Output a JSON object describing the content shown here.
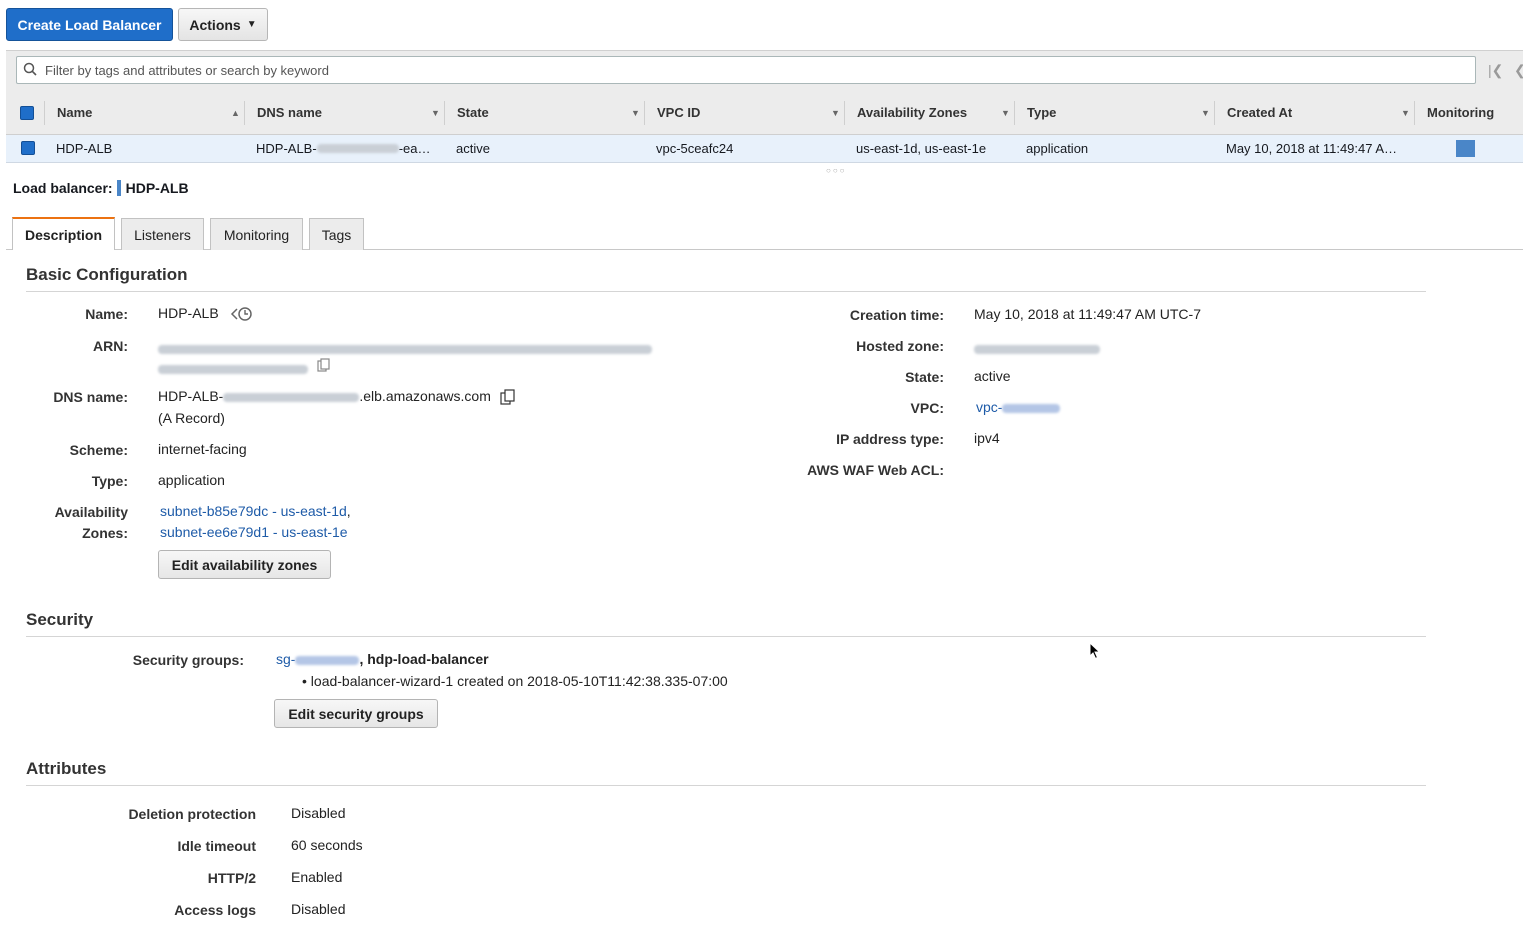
{
  "toolbar": {
    "create_label": "Create Load Balancer",
    "actions_label": "Actions"
  },
  "search": {
    "placeholder": "Filter by tags and attributes or search by keyword"
  },
  "table": {
    "columns": [
      "Name",
      "DNS name",
      "State",
      "VPC ID",
      "Availability Zones",
      "Type",
      "Created At",
      "Monitoring"
    ],
    "rows": [
      {
        "name": "HDP-ALB",
        "dns_prefix": "HDP-ALB-",
        "dns_suffix": "-ea…",
        "state": "active",
        "vpc": "vpc-5ceafc24",
        "azs": "us-east-1d, us-east-1e",
        "type": "application",
        "created": "May 10, 2018 at 11:49:47 A…"
      }
    ]
  },
  "detail": {
    "title_label": "Load balancer:",
    "title_value": "HDP-ALB",
    "tabs": [
      "Description",
      "Listeners",
      "Monitoring",
      "Tags"
    ]
  },
  "basic": {
    "heading": "Basic Configuration",
    "name_label": "Name:",
    "name_value": "HDP-ALB",
    "arn_label": "ARN:",
    "dns_label": "DNS name:",
    "dns_prefix": "HDP-ALB-",
    "dns_suffix": ".elb.amazonaws.com",
    "dns_record": "(A Record)",
    "scheme_label": "Scheme:",
    "scheme_value": "internet-facing",
    "type_label": "Type:",
    "type_value": "application",
    "az_label_1": "Availability",
    "az_label_2": "Zones:",
    "az_1": "subnet-b85e79dc - us-east-1d",
    "az_2": "subnet-ee6e79d1 - us-east-1e",
    "edit_az": "Edit availability zones",
    "creation_label": "Creation time:",
    "creation_value": "May 10, 2018 at 11:49:47 AM UTC-7",
    "hosted_label": "Hosted zone:",
    "state_label": "State:",
    "state_value": "active",
    "vpc_label": "VPC:",
    "vpc_prefix": "vpc-",
    "ip_label": "IP address type:",
    "ip_value": "ipv4",
    "waf_label": "AWS WAF Web ACL:"
  },
  "security": {
    "heading": "Security",
    "sg_label": "Security groups:",
    "sg_prefix": "sg-",
    "sg_name": ", hdp-load-balancer",
    "sg_desc": "• load-balancer-wizard-1 created on 2018-05-10T11:42:38.335-07:00",
    "edit_sg": "Edit security groups"
  },
  "attributes": {
    "heading": "Attributes",
    "items": [
      {
        "label": "Deletion protection",
        "value": "Disabled"
      },
      {
        "label": "Idle timeout",
        "value": "60 seconds"
      },
      {
        "label": "HTTP/2",
        "value": "Enabled"
      },
      {
        "label": "Access logs",
        "value": "Disabled"
      }
    ]
  },
  "colors": {
    "primary": "#1f6ec9",
    "link": "#1e5ba8",
    "tab_accent": "#ec7211",
    "row_selected": "#e8f1fb"
  },
  "icons": [
    "search-icon",
    "chevron-down-icon",
    "first-page-icon",
    "prev-page-icon",
    "history-icon",
    "copy-icon",
    "mouse-cursor-icon"
  ]
}
